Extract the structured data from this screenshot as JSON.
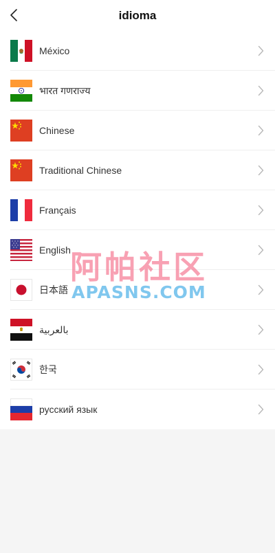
{
  "header": {
    "title": "idioma",
    "back_icon": "chevron-left-icon"
  },
  "languages": [
    {
      "id": "mexico",
      "label": "México",
      "flag": "mexico-flag-icon"
    },
    {
      "id": "india",
      "label": "भारत गणराज्य",
      "flag": "india-flag-icon"
    },
    {
      "id": "chinese",
      "label": "Chinese",
      "flag": "china-flag-icon"
    },
    {
      "id": "traditional-chinese",
      "label": "Traditional Chinese",
      "flag": "china-flag-icon"
    },
    {
      "id": "francais",
      "label": "Français",
      "flag": "france-flag-icon"
    },
    {
      "id": "english",
      "label": "English",
      "flag": "usa-flag-icon"
    },
    {
      "id": "japanese",
      "label": "日本語",
      "flag": "japan-flag-icon"
    },
    {
      "id": "arabic",
      "label": "بالعربية",
      "flag": "egypt-flag-icon"
    },
    {
      "id": "korean",
      "label": "한국",
      "flag": "korea-flag-icon"
    },
    {
      "id": "russian",
      "label": "русский язык",
      "flag": "russia-flag-icon"
    }
  ],
  "row_chevron_icon": "chevron-right-icon",
  "watermark": {
    "line1": "阿帕社区",
    "line2": "APASNS.COM"
  },
  "colors": {
    "header_bg": "#ffffff",
    "page_bg": "#f5f5f5",
    "text": "#333333",
    "chevron": "#b8b8b8",
    "watermark_pink": "#f46e8a",
    "watermark_blue": "#56b4e8"
  }
}
